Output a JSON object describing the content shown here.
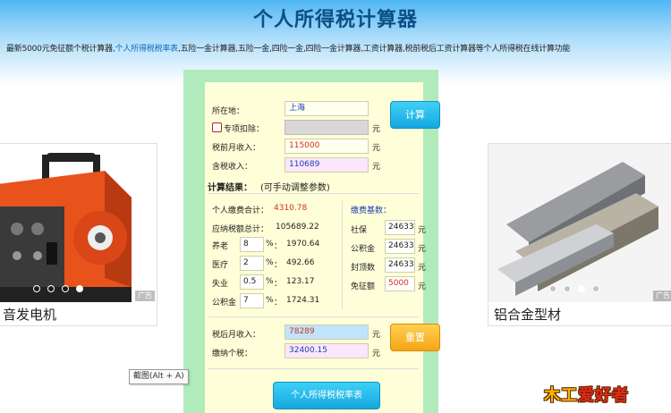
{
  "header": {
    "title": "个人所得税计算器",
    "intro_prefix": "最新5000元免征额个税计算器,",
    "intro_link": "个人所得税税率表",
    "intro_suffix": ",五险一金计算器,五险一金,四险一金,四险一金计算器,工资计算器,税前税后工资计算器等个人所得税在线计算功能"
  },
  "ads": {
    "left": {
      "caption": "音发电机",
      "badge": "广告"
    },
    "right": {
      "caption": "铝合金型材",
      "badge": "广告"
    }
  },
  "form": {
    "location_label": "所在地：",
    "location_value": "上海",
    "special_deduction_label": "专项扣除：",
    "special_deduction_value": "",
    "pretax_label": "税前月收入：",
    "pretax_value": "115000",
    "taxable_label": "含税收入：",
    "taxable_value": "110689",
    "unit": "元",
    "calc_button": "计算"
  },
  "results": {
    "heading": "计算结果：",
    "heading_note": "(可手动调整参数)",
    "personal_total_label": "个人缴费合计：",
    "personal_total_value": "4310.78",
    "taxable_total_label": "应纳税额总计：",
    "taxable_total_value": "105689.22",
    "items": [
      {
        "label": "养老",
        "rate": "8",
        "value": "1970.64"
      },
      {
        "label": "医疗",
        "rate": "2",
        "value": "492.66"
      },
      {
        "label": "失业",
        "rate": "0.5",
        "value": "123.17"
      },
      {
        "label": "公积金",
        "rate": "7",
        "value": "1724.31"
      }
    ],
    "percent_sign": "%",
    "colon": "：",
    "base_heading": "缴费基数：",
    "bases": [
      {
        "label": "社保",
        "value": "24633"
      },
      {
        "label": "公积金",
        "value": "24633"
      },
      {
        "label": "封顶数",
        "value": "24633"
      },
      {
        "label": "免征额",
        "value": "5000"
      }
    ]
  },
  "output": {
    "aftertax_label": "税后月收入：",
    "aftertax_value": "78289",
    "tax_label": "缴纳个税：",
    "tax_value": "32400.15",
    "reset_button": "重置",
    "rate_table_button": "个人所得税税率表"
  },
  "tooltip": "截图(Alt + A)",
  "logo": {
    "text": "木工",
    "accent": "爱好者"
  },
  "colors": {
    "accent_blue": "#14a8e0",
    "title": "#0c4f86",
    "panel_bg": "#fefed8",
    "panel_frame": "#b1ebbc",
    "red_value": "#d6301e",
    "blue_value": "#1c3fb5"
  }
}
